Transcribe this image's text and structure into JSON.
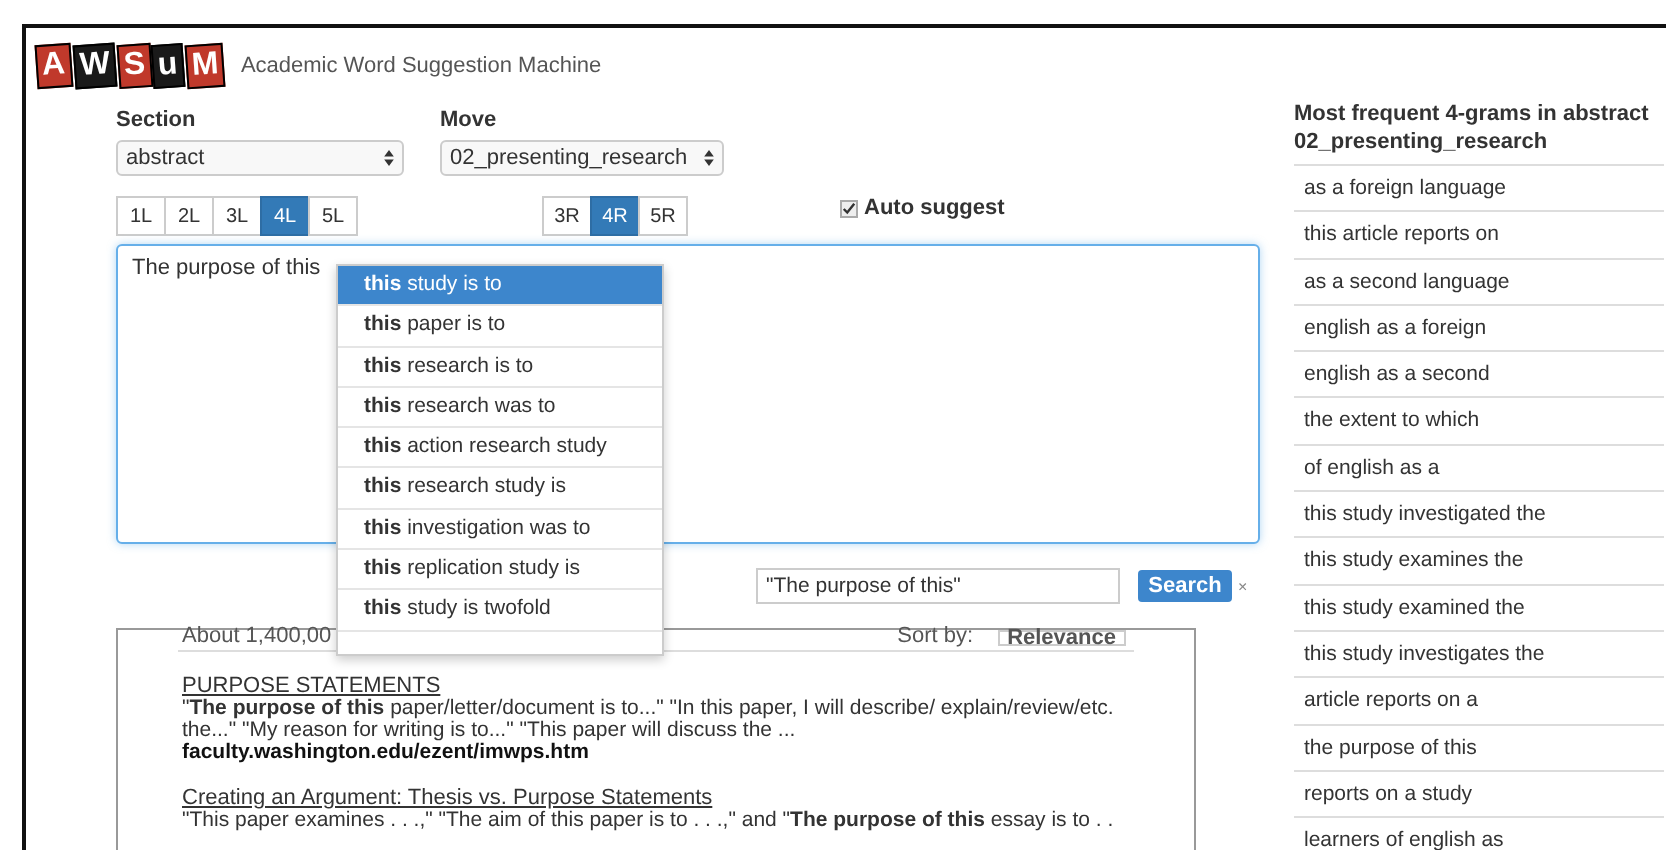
{
  "app": {
    "logo_letters": [
      "A",
      "W",
      "S",
      "u",
      "M"
    ],
    "title": "Academic Word Suggestion Machine"
  },
  "section": {
    "label": "Section",
    "value": "abstract"
  },
  "move": {
    "label": "Move",
    "value": "02_presenting_research"
  },
  "left_buttons": [
    {
      "label": "1L",
      "selected": false
    },
    {
      "label": "2L",
      "selected": false
    },
    {
      "label": "3L",
      "selected": false
    },
    {
      "label": "4L",
      "selected": true
    },
    {
      "label": "5L",
      "selected": false
    }
  ],
  "right_buttons": [
    {
      "label": "3R",
      "selected": false
    },
    {
      "label": "4R",
      "selected": true
    },
    {
      "label": "5R",
      "selected": false
    }
  ],
  "auto_suggest": {
    "label": "Auto suggest",
    "checked": true
  },
  "editor": {
    "value": "The purpose of this "
  },
  "suggestions": [
    {
      "text": "**this** study is to",
      "selected": true
    },
    {
      "text": "**this** paper is to",
      "selected": false
    },
    {
      "text": "**this** research is to",
      "selected": false
    },
    {
      "text": "**this** research was to",
      "selected": false
    },
    {
      "text": "**this** action research study",
      "selected": false
    },
    {
      "text": "**this** research study is",
      "selected": false
    },
    {
      "text": "**this** investigation was to",
      "selected": false
    },
    {
      "text": "**this** replication study is",
      "selected": false
    },
    {
      "text": "**this** study is twofold",
      "selected": false
    }
  ],
  "search": {
    "value": "\"The purpose of this\"",
    "button": "Search",
    "clear": "×"
  },
  "results": {
    "count": "About 1,400,00",
    "sort_label": "Sort by:",
    "sort_value": "Relevance",
    "items": [
      {
        "title": "PURPOSE STATEMENTS",
        "snippet": "\"**The purpose of this** paper/letter/document is to...\" \"In this paper, I will describe/ explain/review/etc. the...\" \"My reason for writing is to...\" \"This paper will discuss the ...",
        "url": "faculty.washington.edu/ezent/imwps.htm"
      },
      {
        "title": "Creating an Argument: Thesis vs. Purpose Statements",
        "snippet": "\"This paper examines . . .,\" \"The aim of this paper is to . . .,\" and \"**The purpose of this** essay is to . ."
      }
    ]
  },
  "ngrams": {
    "heading": "Most frequent 4-grams in abstract 02_presenting_research",
    "items": [
      "as a foreign language",
      "this article reports on",
      "as a second language",
      "english as a foreign",
      "english as a second",
      "the extent to which",
      "of english as a",
      "this study investigated the",
      "this study examines the",
      "this study examined the",
      "this study investigates the",
      "article reports on a",
      "the purpose of this",
      "reports on a study",
      "learners of english as"
    ]
  }
}
